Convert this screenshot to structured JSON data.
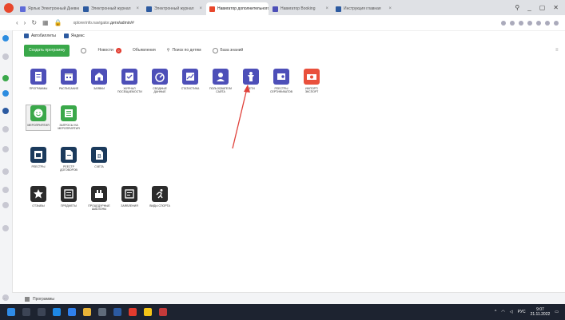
{
  "browser": {
    "tabs": [
      {
        "label": "Ярлык Электронный Дневник — С...",
        "color": "#5f6bd8",
        "active": false
      },
      {
        "label": "Электронный журнал",
        "color": "#2c5aa0",
        "active": false
      },
      {
        "label": "Электронный журнал",
        "color": "#2c5aa0",
        "active": false
      },
      {
        "label": "Навигатор дополнительного о...",
        "color": "#e8472c",
        "active": true
      },
      {
        "label": "Навигатор Booking",
        "color": "#4d4fb8",
        "active": false
      },
      {
        "label": "Инструкция главная",
        "color": "#2c5aa0",
        "active": false
      }
    ],
    "url_host": "xplorerinfo.navigator.",
    "url_path": "дети/admin/#",
    "bookmarks": [
      "Автобиллеты",
      "Яндекс"
    ]
  },
  "toolbar": {
    "create_label": "Создать программу",
    "news_label": "Новости",
    "news_count": "0",
    "announcements_label": "Объявления",
    "search_label": "Поиск по детям",
    "kb_label": "База знаний"
  },
  "rows": [
    [
      {
        "label": "Программы",
        "color": "purple",
        "icon": "document-icon"
      },
      {
        "label": "Расписание",
        "color": "purple",
        "icon": "calendar-icon"
      },
      {
        "label": "Заявки",
        "color": "purple",
        "icon": "store-icon"
      },
      {
        "label": "Журнал посещаемости",
        "color": "purple",
        "icon": "schedule-icon"
      },
      {
        "label": "Сводные данные",
        "color": "purple",
        "icon": "dashboard-icon"
      },
      {
        "label": "Статистика",
        "color": "purple",
        "icon": "chart-icon"
      },
      {
        "label": "Пользователи сайта",
        "color": "purple",
        "icon": "user-icon"
      },
      {
        "label": "Дети",
        "color": "purple",
        "icon": "child-icon"
      },
      {
        "label": "Реестры сертификатов",
        "color": "purple",
        "icon": "certificate-icon"
      },
      {
        "label": "Импорт/экспорт",
        "color": "orange",
        "icon": "money-icon"
      }
    ],
    [
      {
        "label": "Мероприятия",
        "color": "green",
        "icon": "smile-icon",
        "selected": true
      },
      {
        "label": "Запросы на мероприятия",
        "color": "green",
        "icon": "list-icon"
      }
    ],
    [
      {
        "label": "Реестры",
        "color": "dark",
        "icon": "registry-icon"
      },
      {
        "label": "Реестр договоров",
        "color": "dark",
        "icon": "file-icon"
      },
      {
        "label": "Счета",
        "color": "dark",
        "icon": "invoice-icon"
      }
    ],
    [
      {
        "label": "Отзывы",
        "color": "charcoal",
        "icon": "star-icon"
      },
      {
        "label": "Предметы",
        "color": "charcoal",
        "icon": "list2-icon"
      },
      {
        "label": "Процедурные шаблоны",
        "color": "charcoal",
        "icon": "building-icon"
      },
      {
        "label": "Заявления",
        "color": "charcoal",
        "icon": "form-icon"
      },
      {
        "label": "Виды спорта",
        "color": "charcoal",
        "icon": "run-icon"
      }
    ]
  ],
  "statusbar": {
    "programs_label": "Программы"
  },
  "taskbar": {
    "lang": "РУС",
    "time": "9:07",
    "date": "21.11.2022"
  },
  "colors": {
    "purple": "#4d4fb8",
    "orange": "#e9503c",
    "green": "#3aa84a",
    "dark": "#1b3a5c",
    "charcoal": "#2b2b2b",
    "arrow": "#e0413a"
  }
}
